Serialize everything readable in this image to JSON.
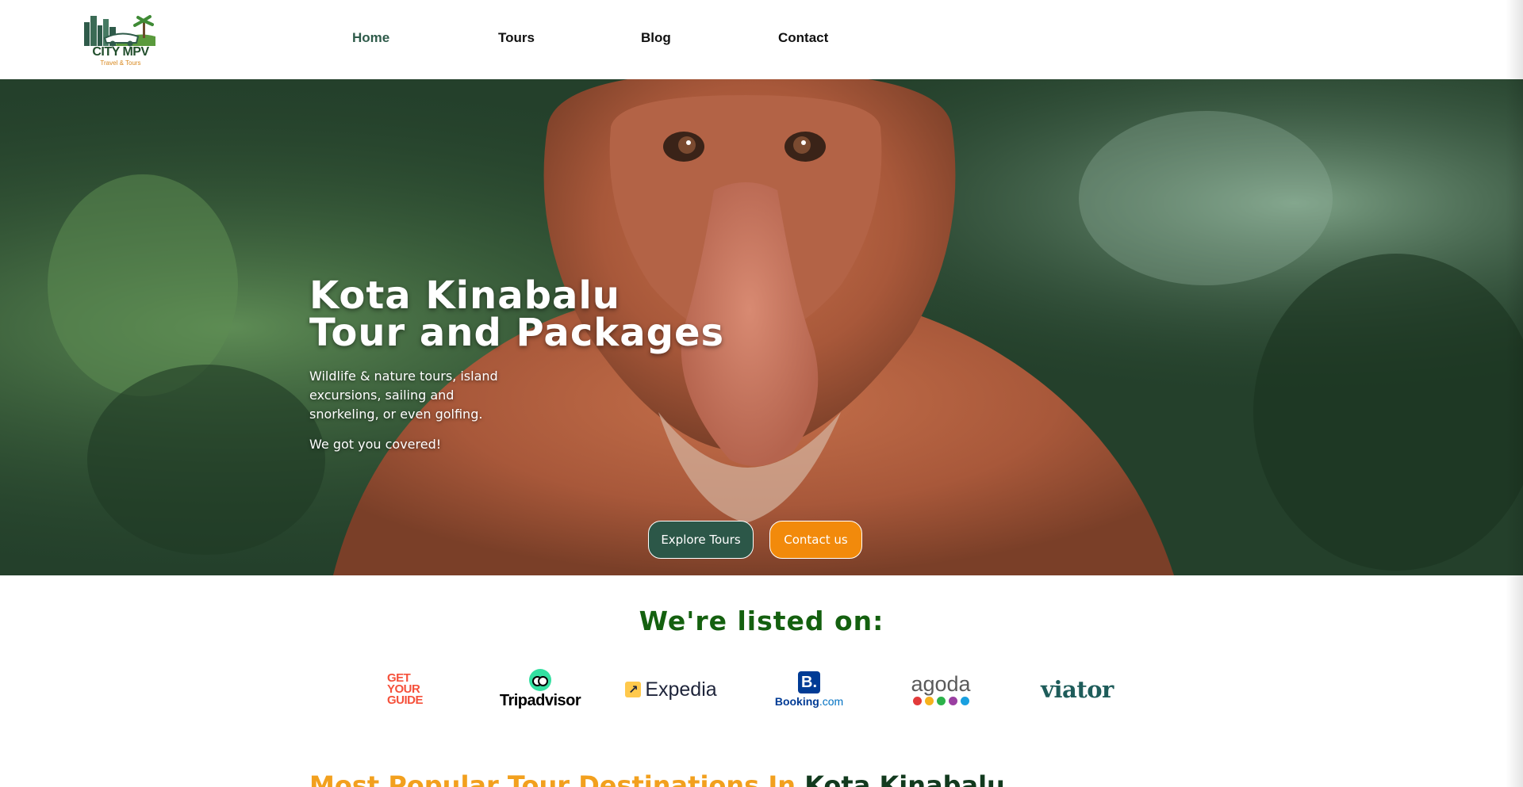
{
  "brand": {
    "logo_text": "CITY MPV",
    "logo_subtext": "Travel & Tours",
    "colors": {
      "primary": "#2c5748",
      "accent": "#f28a0b",
      "heading_green": "#14600f",
      "popular_orange": "#f2a01e"
    }
  },
  "nav": {
    "items": [
      {
        "label": "Home",
        "active": true
      },
      {
        "label": "Tours",
        "active": false
      },
      {
        "label": "Blog",
        "active": false
      },
      {
        "label": "Contact",
        "active": false
      }
    ]
  },
  "hero": {
    "title_line1": "Kota Kinabalu",
    "title_line2": "Tour and Packages",
    "description": "Wildlife & nature tours, island excursions, sailing and snorkeling, or even golfing.",
    "tagline": "We got you covered!",
    "background_icon": "proboscis-monkey-photo",
    "buttons": {
      "explore_label": "Explore Tours",
      "contact_label": "Contact us"
    }
  },
  "listed_on": {
    "title": "We're listed on:",
    "partners": [
      {
        "name": "GetYourGuide",
        "lines": [
          "GET",
          "YOUR",
          "GUIDE"
        ]
      },
      {
        "name": "Tripadvisor",
        "text": "Tripadvisor"
      },
      {
        "name": "Expedia",
        "text": "Expedia"
      },
      {
        "name": "Booking.com",
        "icon_letter": "B.",
        "text_main": "Booking",
        "text_suffix": ".com"
      },
      {
        "name": "agoda",
        "text": "agoda",
        "dots": [
          "#e23a3a",
          "#f6b21d",
          "#2cb24a",
          "#9a3fa1",
          "#1aa0e0"
        ]
      },
      {
        "name": "viator",
        "text": "viator"
      }
    ]
  },
  "popular": {
    "heading_part1": "Most Popular Tour Destinations In",
    "heading_part2": "Kota Kinabalu"
  }
}
